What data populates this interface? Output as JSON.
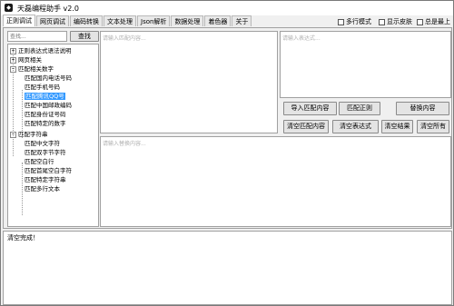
{
  "app": {
    "icon": "app-logo-icon",
    "title": "天磊编程助手 v2.0"
  },
  "tabs": [
    {
      "label": "正则调试"
    },
    {
      "label": "网页调试"
    },
    {
      "label": "编码转换"
    },
    {
      "label": "文本处理"
    },
    {
      "label": "Json解析"
    },
    {
      "label": "数据处理"
    },
    {
      "label": "着色器"
    },
    {
      "label": "关于"
    }
  ],
  "options": {
    "multiline": "多行模式",
    "skin": "显示皮肤",
    "topmost": "总是最上"
  },
  "search": {
    "placeholder": "查找...",
    "button": "查找"
  },
  "tree": {
    "group1": "正则表达式语法说明",
    "group2": "网页相关",
    "group3": "匹配相关数字",
    "g3_items": [
      "匹配国内电话号码",
      "匹配手机号码",
      "匹配腾讯QQ号",
      "匹配中国邮政编码",
      "匹配身份证号码",
      "匹配特定的数字"
    ],
    "group4": "匹配字符串",
    "g4_items": [
      "匹配中文字符",
      "匹配双字节字符",
      "匹配空白行",
      "匹配首尾空白字符",
      "匹配特定字符串",
      "匹配多行文本"
    ]
  },
  "editor": {
    "match_placeholder": "请输入匹配内容...",
    "regex_placeholder": "请输入表达式...",
    "result_placeholder": "请输入替换内容..."
  },
  "buttons": {
    "import": "导入匹配内容",
    "match": "匹配正则",
    "replace": "替换内容",
    "clear_match": "清空匹配内容",
    "clear_regex": "清空表达式",
    "clear_result": "清空结果",
    "clear_all": "清空所有"
  },
  "status": {
    "text": "清空完成！"
  },
  "colors": {
    "selection": "#3399ff",
    "window_bg": "#f0f0f0"
  }
}
